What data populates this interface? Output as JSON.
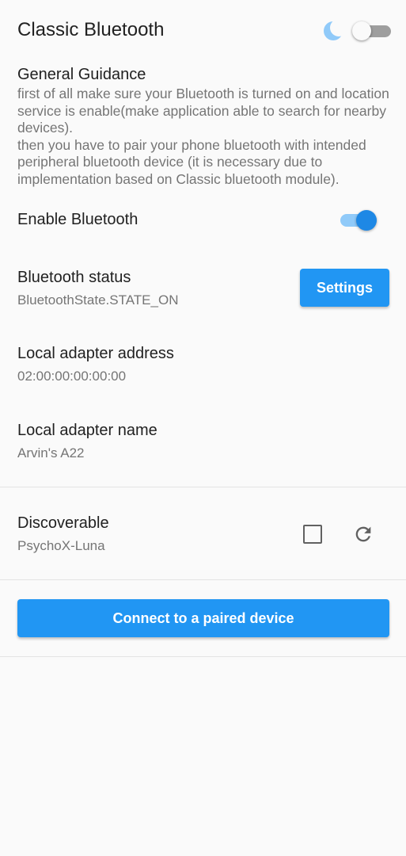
{
  "header": {
    "title": "Classic Bluetooth",
    "theme_toggle_on": false,
    "moon_icon": "moon-icon"
  },
  "guidance": {
    "title": "General Guidance",
    "text": "first of all make sure your Bluetooth is turned on and location service is enable(make application able to search for nearby devices).\nthen you have to pair your phone bluetooth with intended peripheral bluetooth device (it is necessary due to implementation based on Classic bluetooth module)."
  },
  "enable_bluetooth": {
    "label": "Enable Bluetooth",
    "on": true
  },
  "bluetooth_status": {
    "title": "Bluetooth status",
    "value": "BluetoothState.STATE_ON",
    "settings_label": "Settings"
  },
  "adapter_address": {
    "title": "Local adapter address",
    "value": "02:00:00:00:00:00"
  },
  "adapter_name": {
    "title": "Local adapter name",
    "value": "Arvin's A22"
  },
  "discoverable": {
    "title": "Discoverable",
    "value": "PsychoX-Luna",
    "checked": false,
    "refresh_icon": "refresh-icon"
  },
  "connect": {
    "label": "Connect to a paired device"
  },
  "colors": {
    "primary": "#2196f3",
    "switch_track_on": "#90caf9",
    "switch_thumb_on": "#1e88e5",
    "moon": "#90caf9"
  }
}
